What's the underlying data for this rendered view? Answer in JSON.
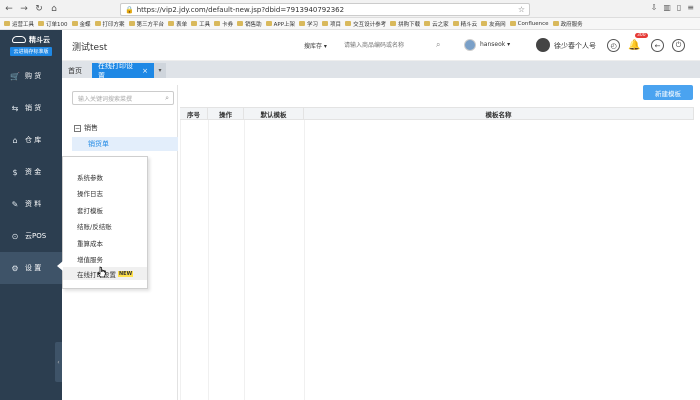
{
  "browser": {
    "url": "https://vip2.jdy.com/default-new.jsp?dbid=7913940792362",
    "bookmarks": [
      "运营工具",
      "订单100",
      "金蝶",
      "打印方案",
      "第三方平台",
      "表单",
      "工具",
      "卡券",
      "销售助",
      "APP上架",
      "学习",
      "项目",
      "交互设计参考",
      "拼购下载",
      "云之家",
      "精斗云",
      "友商网",
      "Confluence",
      "政府服务"
    ]
  },
  "sidebar": {
    "logo_text": "精斗云",
    "logo_sub": "云进销存标准版",
    "items": [
      {
        "label": "购 货",
        "icon": "cart-icon",
        "glyph": "🛒"
      },
      {
        "label": "销 货",
        "icon": "truck-icon",
        "glyph": "⇆"
      },
      {
        "label": "仓 库",
        "icon": "warehouse-icon",
        "glyph": "⌂"
      },
      {
        "label": "资 金",
        "icon": "money-icon",
        "glyph": "$"
      },
      {
        "label": "资 料",
        "icon": "pen-icon",
        "glyph": "✎"
      },
      {
        "label": "云POS",
        "icon": "pos-icon",
        "glyph": "⊙"
      },
      {
        "label": "设 置",
        "icon": "gear-icon",
        "glyph": "⚙"
      }
    ],
    "collapse_glyph": "‹"
  },
  "header": {
    "app_title": "测试test",
    "search_scope": "搜库存 ▾",
    "search_placeholder": "请输入商品编码或名称",
    "username": "hanseok ▾",
    "profile_name": "徐少春个人号",
    "notify_badge": "300"
  },
  "tabs": {
    "home": "首页",
    "active": "在线打印设置",
    "close": "×",
    "more": "▾"
  },
  "tree": {
    "search_placeholder": "输入关键词搜索菜撰",
    "root_label": "销售",
    "child_label": "销货单"
  },
  "content": {
    "new_button": "新建模板",
    "columns": [
      "序号",
      "操作",
      "默认模板",
      "模板名称"
    ]
  },
  "settings_menu": {
    "items": [
      "系统参数",
      "操作日志",
      "套打模板",
      "结账/反结账",
      "重算成本",
      "增值服务",
      "在线打印设置"
    ],
    "new_badge": "NEW"
  },
  "colors": {
    "sidebar": "#2c3e50",
    "accent": "#1e88e5",
    "button": "#4aa3f0"
  }
}
